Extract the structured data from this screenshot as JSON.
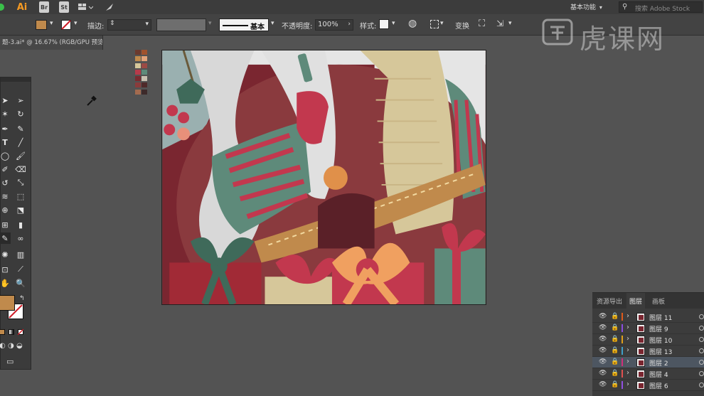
{
  "app": {
    "logo": "Ai",
    "bridge": "Br",
    "stock": "St",
    "workspace": "基本功能",
    "search_placeholder": "搜索 Adobe Stock"
  },
  "control_bar": {
    "stroke_label": "描边:",
    "stroke_style": "基本",
    "opacity_label": "不透明度:",
    "opacity_value": "100%",
    "style_label": "样式:",
    "transform_label": "变换",
    "fill_color": "#c08a4c"
  },
  "document": {
    "tab_title": "题-3.ai* @ 16.67% (RGB/GPU 预览)"
  },
  "watermark": {
    "text": "虎课网"
  },
  "layers_panel": {
    "tabs": [
      "资源导出",
      "图层",
      "画板"
    ],
    "active_tab": 1,
    "layers": [
      {
        "name": "图层 11",
        "color": "#e05a1a",
        "selected": false
      },
      {
        "name": "图层 9",
        "color": "#8a4de0",
        "selected": false
      },
      {
        "name": "图层 10",
        "color": "#e0a01a",
        "selected": false
      },
      {
        "name": "图层 13",
        "color": "#3fa0c8",
        "selected": false
      },
      {
        "name": "图层 2",
        "color": "#d0307a",
        "selected": true
      },
      {
        "name": "图层 4",
        "color": "#e05050",
        "selected": false
      },
      {
        "name": "图层 6",
        "color": "#9050e0",
        "selected": false
      }
    ]
  },
  "swatches": [
    "#6b3a2e",
    "#a0522d",
    "#c08a4c",
    "#e2a37a",
    "#d6c79a",
    "#9b4a45",
    "#b63a4a",
    "#5e8a7a",
    "#7a2a30",
    "#c8c0b0",
    "#8a3b3b",
    "#4f2a2a",
    "#a36b4f",
    "#3d2a2a",
    "#d9a060",
    "#e8e0d0"
  ]
}
